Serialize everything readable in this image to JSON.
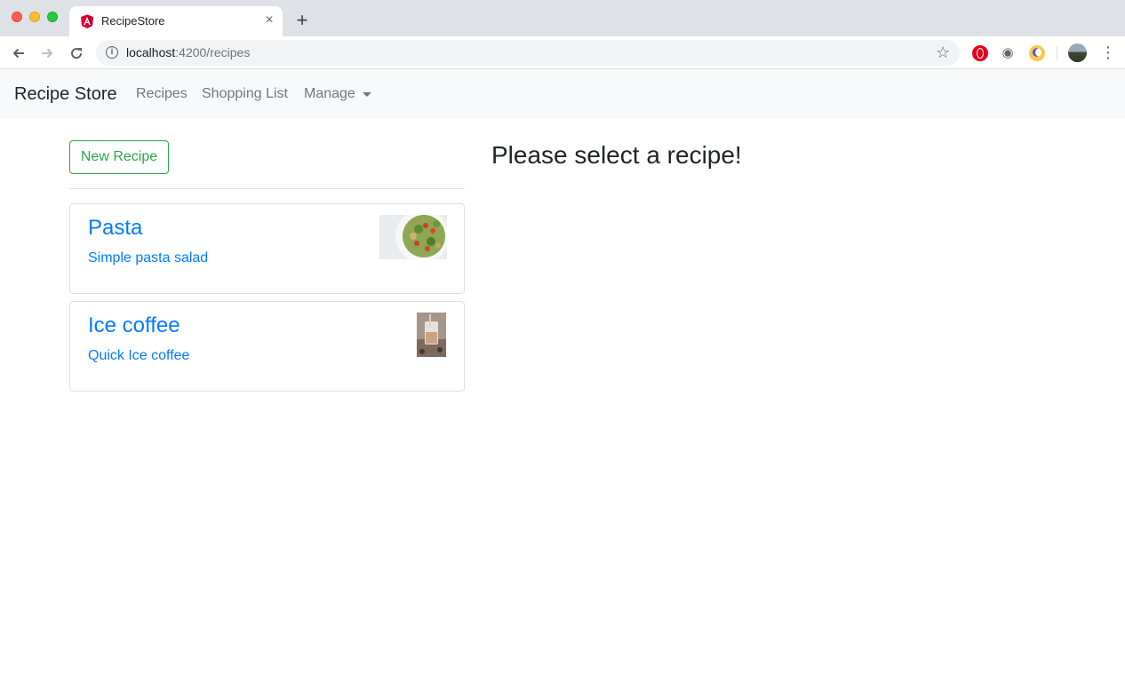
{
  "browser": {
    "tab_title": "RecipeStore",
    "new_tab_symbol": "+",
    "tab_close_symbol": "×",
    "url_host": "localhost",
    "url_path": ":4200/recipes",
    "icons": [
      "angular-favicon-icon",
      "back-arrow-icon",
      "forward-arrow-icon",
      "reload-icon",
      "site-info-icon",
      "bookmark-star-icon",
      "opera-extension-icon",
      "eye-extension-icon",
      "moon-extension-icon",
      "profile-avatar-icon",
      "chrome-menu-icon"
    ]
  },
  "navbar": {
    "brand": "Recipe Store",
    "links": {
      "recipes": "Recipes",
      "shopping_list": "Shopping List",
      "manage": "Manage"
    }
  },
  "recipe_list": {
    "new_recipe_label": "New Recipe",
    "items": [
      {
        "name": "Pasta",
        "description": "Simple pasta salad"
      },
      {
        "name": "Ice coffee",
        "description": "Quick Ice coffee"
      }
    ]
  },
  "detail": {
    "placeholder": "Please select a recipe!"
  },
  "colors": {
    "accent_link": "#007bff",
    "success": "#28a745",
    "navbar_bg": "#f8f9fa"
  }
}
